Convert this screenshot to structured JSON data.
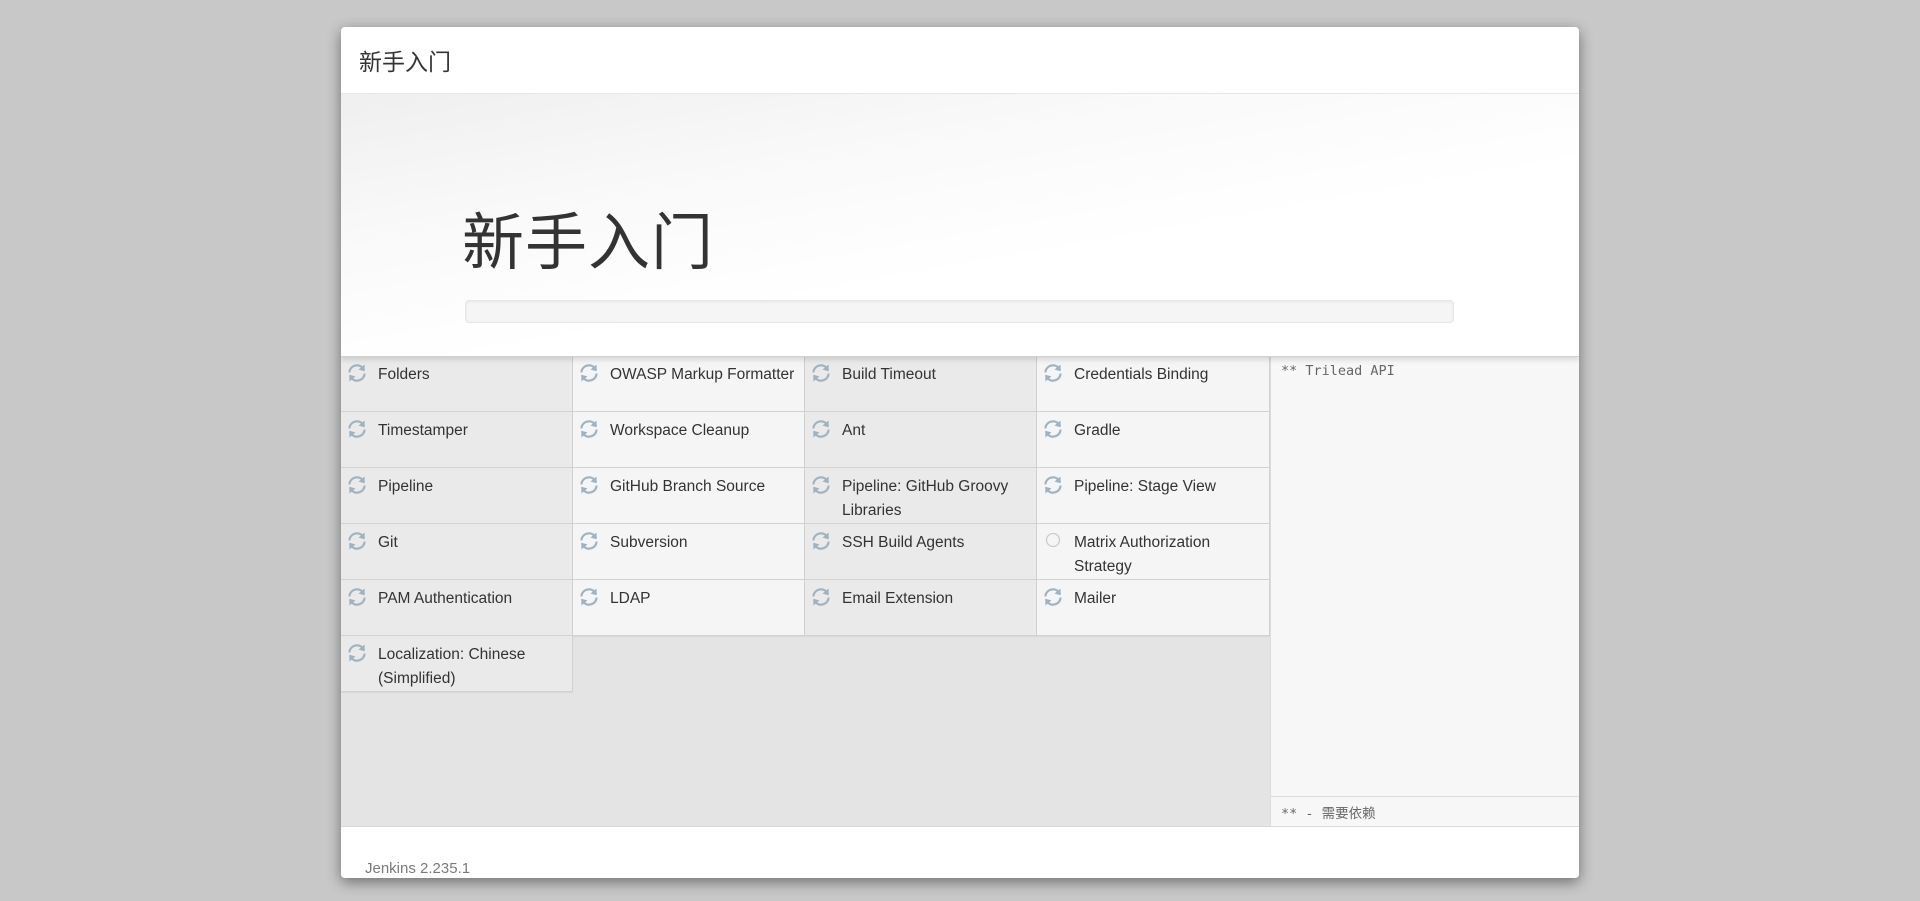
{
  "header": {
    "title": "新手入门"
  },
  "jumbotron": {
    "title": "新手入门",
    "progress_fraction": 0.0
  },
  "plugins": [
    {
      "name": "Folders",
      "status": "installing",
      "icon": "refresh-icon"
    },
    {
      "name": "OWASP Markup Formatter",
      "status": "installing",
      "icon": "refresh-icon"
    },
    {
      "name": "Build Timeout",
      "status": "installing",
      "icon": "refresh-icon"
    },
    {
      "name": "Credentials Binding",
      "status": "installing",
      "icon": "refresh-icon"
    },
    {
      "name": "Timestamper",
      "status": "installing",
      "icon": "refresh-icon"
    },
    {
      "name": "Workspace Cleanup",
      "status": "installing",
      "icon": "refresh-icon"
    },
    {
      "name": "Ant",
      "status": "installing",
      "icon": "refresh-icon"
    },
    {
      "name": "Gradle",
      "status": "installing",
      "icon": "refresh-icon"
    },
    {
      "name": "Pipeline",
      "status": "installing",
      "icon": "refresh-icon"
    },
    {
      "name": "GitHub Branch Source",
      "status": "installing",
      "icon": "refresh-icon"
    },
    {
      "name": "Pipeline: GitHub Groovy Libraries",
      "status": "installing",
      "icon": "refresh-icon"
    },
    {
      "name": "Pipeline: Stage View",
      "status": "installing",
      "icon": "refresh-icon"
    },
    {
      "name": "Git",
      "status": "installing",
      "icon": "refresh-icon"
    },
    {
      "name": "Subversion",
      "status": "installing",
      "icon": "refresh-icon"
    },
    {
      "name": "SSH Build Agents",
      "status": "installing",
      "icon": "refresh-icon"
    },
    {
      "name": "Matrix Authorization Strategy",
      "status": "pending",
      "icon": "pending-circle-icon"
    },
    {
      "name": "PAM Authentication",
      "status": "installing",
      "icon": "refresh-icon"
    },
    {
      "name": "LDAP",
      "status": "installing",
      "icon": "refresh-icon"
    },
    {
      "name": "Email Extension",
      "status": "installing",
      "icon": "refresh-icon"
    },
    {
      "name": "Mailer",
      "status": "installing",
      "icon": "refresh-icon"
    },
    {
      "name": "Localization: Chinese (Simplified)",
      "status": "installing",
      "icon": "refresh-icon"
    }
  ],
  "details": {
    "log": "** Trilead API",
    "legend": "** - 需要依赖"
  },
  "footer": {
    "version": "Jenkins 2.235.1"
  },
  "colors": {
    "background": "#c8c8c8",
    "icon": "#a0b2bd",
    "pending_icon": "#cccccc"
  }
}
